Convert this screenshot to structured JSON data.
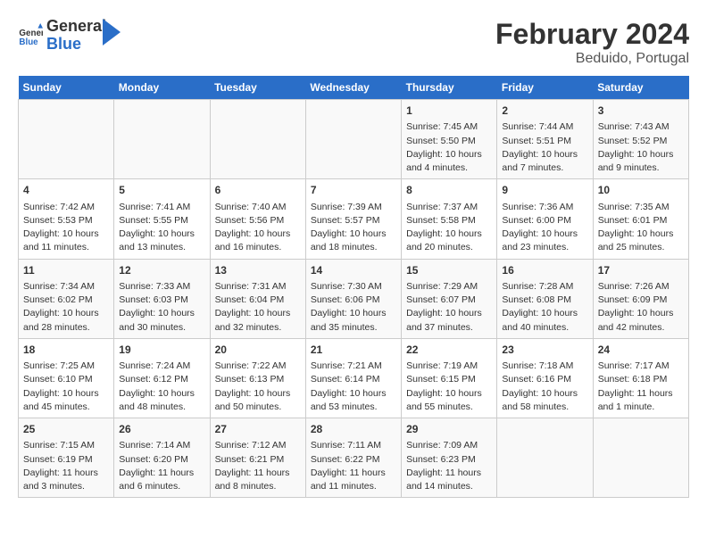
{
  "header": {
    "logo_general": "General",
    "logo_blue": "Blue",
    "title": "February 2024",
    "subtitle": "Beduido, Portugal"
  },
  "days_of_week": [
    "Sunday",
    "Monday",
    "Tuesday",
    "Wednesday",
    "Thursday",
    "Friday",
    "Saturday"
  ],
  "weeks": [
    [
      {
        "day": "",
        "info": ""
      },
      {
        "day": "",
        "info": ""
      },
      {
        "day": "",
        "info": ""
      },
      {
        "day": "",
        "info": ""
      },
      {
        "day": "1",
        "info": "Sunrise: 7:45 AM\nSunset: 5:50 PM\nDaylight: 10 hours\nand 4 minutes."
      },
      {
        "day": "2",
        "info": "Sunrise: 7:44 AM\nSunset: 5:51 PM\nDaylight: 10 hours\nand 7 minutes."
      },
      {
        "day": "3",
        "info": "Sunrise: 7:43 AM\nSunset: 5:52 PM\nDaylight: 10 hours\nand 9 minutes."
      }
    ],
    [
      {
        "day": "4",
        "info": "Sunrise: 7:42 AM\nSunset: 5:53 PM\nDaylight: 10 hours\nand 11 minutes."
      },
      {
        "day": "5",
        "info": "Sunrise: 7:41 AM\nSunset: 5:55 PM\nDaylight: 10 hours\nand 13 minutes."
      },
      {
        "day": "6",
        "info": "Sunrise: 7:40 AM\nSunset: 5:56 PM\nDaylight: 10 hours\nand 16 minutes."
      },
      {
        "day": "7",
        "info": "Sunrise: 7:39 AM\nSunset: 5:57 PM\nDaylight: 10 hours\nand 18 minutes."
      },
      {
        "day": "8",
        "info": "Sunrise: 7:37 AM\nSunset: 5:58 PM\nDaylight: 10 hours\nand 20 minutes."
      },
      {
        "day": "9",
        "info": "Sunrise: 7:36 AM\nSunset: 6:00 PM\nDaylight: 10 hours\nand 23 minutes."
      },
      {
        "day": "10",
        "info": "Sunrise: 7:35 AM\nSunset: 6:01 PM\nDaylight: 10 hours\nand 25 minutes."
      }
    ],
    [
      {
        "day": "11",
        "info": "Sunrise: 7:34 AM\nSunset: 6:02 PM\nDaylight: 10 hours\nand 28 minutes."
      },
      {
        "day": "12",
        "info": "Sunrise: 7:33 AM\nSunset: 6:03 PM\nDaylight: 10 hours\nand 30 minutes."
      },
      {
        "day": "13",
        "info": "Sunrise: 7:31 AM\nSunset: 6:04 PM\nDaylight: 10 hours\nand 32 minutes."
      },
      {
        "day": "14",
        "info": "Sunrise: 7:30 AM\nSunset: 6:06 PM\nDaylight: 10 hours\nand 35 minutes."
      },
      {
        "day": "15",
        "info": "Sunrise: 7:29 AM\nSunset: 6:07 PM\nDaylight: 10 hours\nand 37 minutes."
      },
      {
        "day": "16",
        "info": "Sunrise: 7:28 AM\nSunset: 6:08 PM\nDaylight: 10 hours\nand 40 minutes."
      },
      {
        "day": "17",
        "info": "Sunrise: 7:26 AM\nSunset: 6:09 PM\nDaylight: 10 hours\nand 42 minutes."
      }
    ],
    [
      {
        "day": "18",
        "info": "Sunrise: 7:25 AM\nSunset: 6:10 PM\nDaylight: 10 hours\nand 45 minutes."
      },
      {
        "day": "19",
        "info": "Sunrise: 7:24 AM\nSunset: 6:12 PM\nDaylight: 10 hours\nand 48 minutes."
      },
      {
        "day": "20",
        "info": "Sunrise: 7:22 AM\nSunset: 6:13 PM\nDaylight: 10 hours\nand 50 minutes."
      },
      {
        "day": "21",
        "info": "Sunrise: 7:21 AM\nSunset: 6:14 PM\nDaylight: 10 hours\nand 53 minutes."
      },
      {
        "day": "22",
        "info": "Sunrise: 7:19 AM\nSunset: 6:15 PM\nDaylight: 10 hours\nand 55 minutes."
      },
      {
        "day": "23",
        "info": "Sunrise: 7:18 AM\nSunset: 6:16 PM\nDaylight: 10 hours\nand 58 minutes."
      },
      {
        "day": "24",
        "info": "Sunrise: 7:17 AM\nSunset: 6:18 PM\nDaylight: 11 hours\nand 1 minute."
      }
    ],
    [
      {
        "day": "25",
        "info": "Sunrise: 7:15 AM\nSunset: 6:19 PM\nDaylight: 11 hours\nand 3 minutes."
      },
      {
        "day": "26",
        "info": "Sunrise: 7:14 AM\nSunset: 6:20 PM\nDaylight: 11 hours\nand 6 minutes."
      },
      {
        "day": "27",
        "info": "Sunrise: 7:12 AM\nSunset: 6:21 PM\nDaylight: 11 hours\nand 8 minutes."
      },
      {
        "day": "28",
        "info": "Sunrise: 7:11 AM\nSunset: 6:22 PM\nDaylight: 11 hours\nand 11 minutes."
      },
      {
        "day": "29",
        "info": "Sunrise: 7:09 AM\nSunset: 6:23 PM\nDaylight: 11 hours\nand 14 minutes."
      },
      {
        "day": "",
        "info": ""
      },
      {
        "day": "",
        "info": ""
      }
    ]
  ]
}
